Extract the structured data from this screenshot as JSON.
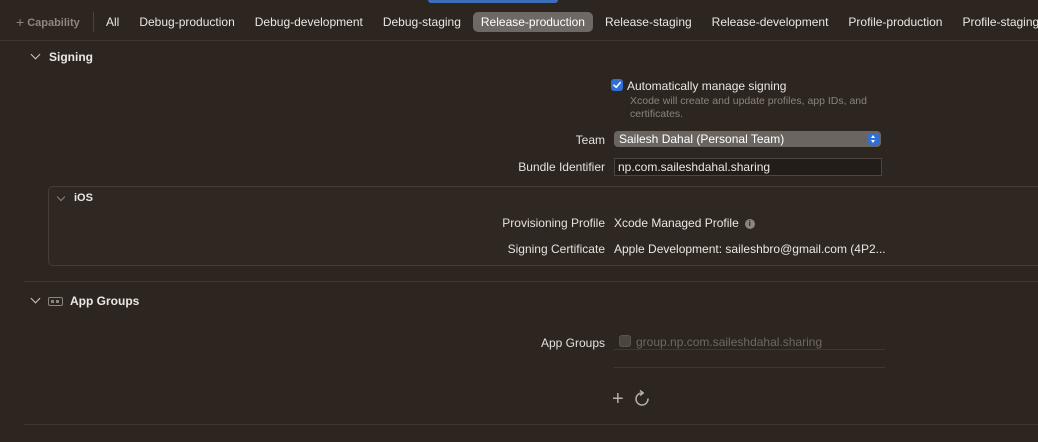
{
  "tabbar": {
    "capability_label": "Capability",
    "tabs": [
      {
        "label": "All",
        "active": false
      },
      {
        "label": "Debug-production",
        "active": false
      },
      {
        "label": "Debug-development",
        "active": false
      },
      {
        "label": "Debug-staging",
        "active": false
      },
      {
        "label": "Release-production",
        "active": true
      },
      {
        "label": "Release-staging",
        "active": false
      },
      {
        "label": "Release-development",
        "active": false
      },
      {
        "label": "Profile-production",
        "active": false
      },
      {
        "label": "Profile-staging",
        "active": false
      }
    ]
  },
  "signing": {
    "title": "Signing",
    "auto_manage": {
      "label": "Automatically manage signing",
      "checked": true,
      "help_line1": "Xcode will create and update profiles, app IDs, and",
      "help_line2": "certificates."
    },
    "team": {
      "label": "Team",
      "value": "Sailesh Dahal (Personal Team)"
    },
    "bundle": {
      "label": "Bundle Identifier",
      "value": "np.com.saileshdahal.sharing"
    },
    "ios": {
      "title": "iOS",
      "provisioning": {
        "label": "Provisioning Profile",
        "value": "Xcode Managed Profile"
      },
      "certificate": {
        "label": "Signing Certificate",
        "value": "Apple Development: saileshbro@gmail.com (4P2..."
      }
    }
  },
  "app_groups": {
    "title": "App Groups",
    "label": "App Groups",
    "items": [
      {
        "value": "group.np.com.saileshdahal.sharing",
        "checked": false
      }
    ]
  },
  "colors": {
    "accent": "#2f6fd6",
    "background": "#2c2520"
  }
}
